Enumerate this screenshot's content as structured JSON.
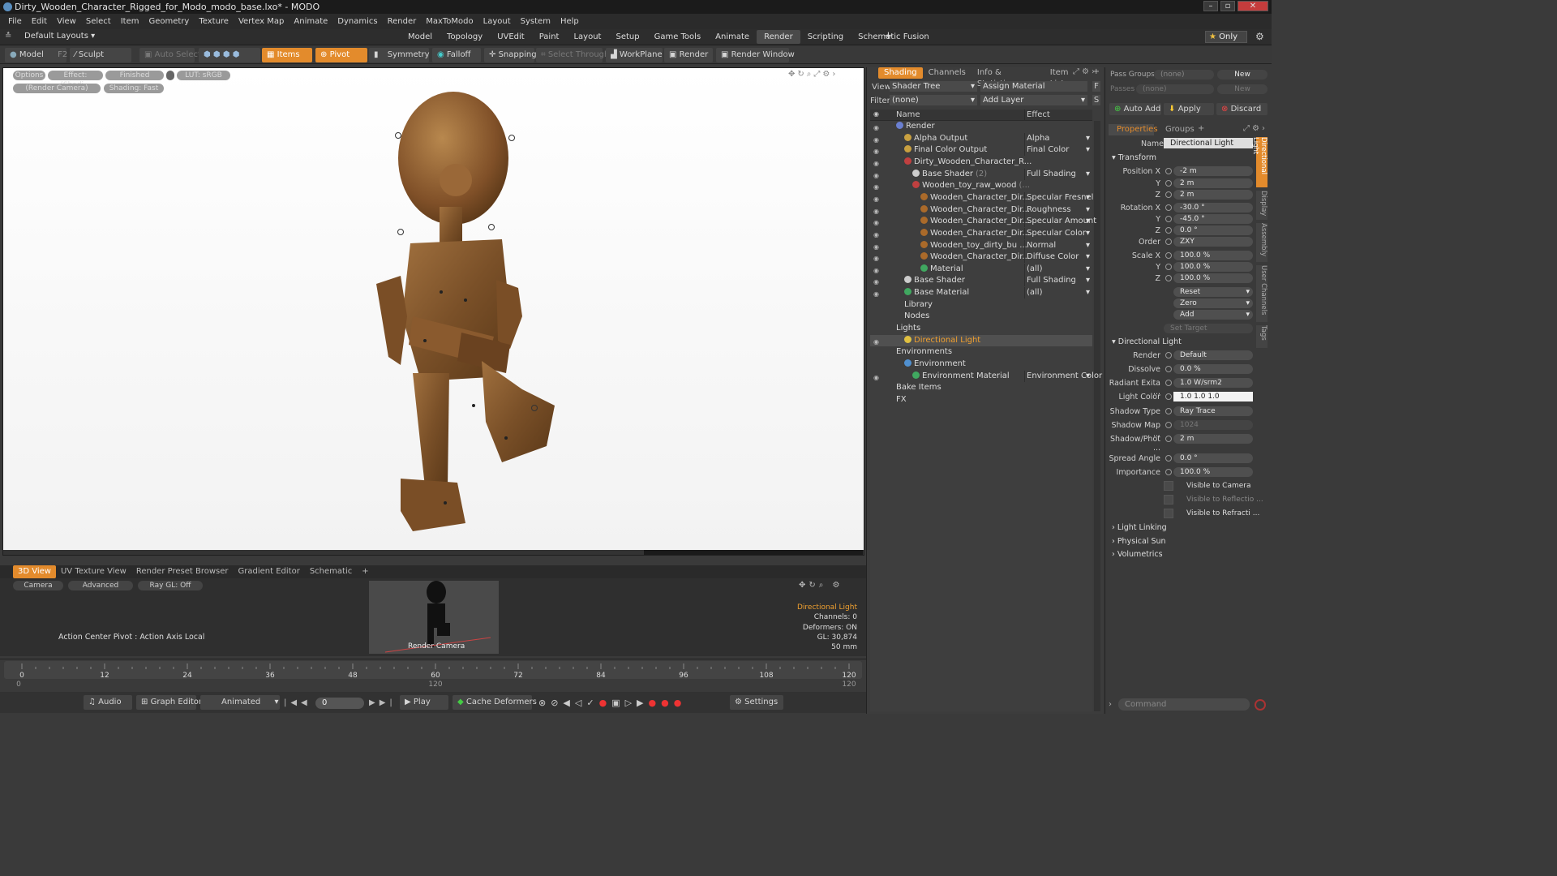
{
  "window": {
    "title": "Dirty_Wooden_Character_Rigged_for_Modo_modo_base.lxo* - MODO"
  },
  "menu": [
    "File",
    "Edit",
    "View",
    "Select",
    "Item",
    "Geometry",
    "Texture",
    "Vertex Map",
    "Animate",
    "Dynamics",
    "Render",
    "MaxToModo",
    "Layout",
    "System",
    "Help"
  ],
  "layoutbar": {
    "layout_label": "Default Layouts",
    "tabs": [
      "Model",
      "Topology",
      "UVEdit",
      "Paint",
      "Layout",
      "Setup",
      "Game Tools",
      "Animate",
      "Render",
      "Scripting",
      "Schematic Fusion"
    ],
    "active_tab": "Render",
    "only_label": "Only"
  },
  "toolbar": {
    "model": "Model",
    "model_key": "F2",
    "sculpt": "Sculpt",
    "auto_select": "Auto Select",
    "items": "Items",
    "pivot": "Pivot",
    "symmetry": "Symmetry",
    "falloff": "Falloff",
    "snapping": "Snapping",
    "select_through": "Select Through",
    "workplane": "WorkPlane",
    "render": "Render",
    "render_window": "Render Window"
  },
  "viewport": {
    "options": "Options",
    "effect": "Effect: (Shadi...",
    "finished": "Finished",
    "lut": "LUT: sRGB",
    "camera": "(Render Camera)",
    "shading": "Shading: Fast"
  },
  "bottom_tabs": [
    "3D View",
    "UV Texture View",
    "Render Preset Browser",
    "Gradient Editor",
    "Schematic"
  ],
  "bottom_active": "3D View",
  "bottom_view": {
    "camera": "Camera",
    "advanced": "Advanced",
    "raygl": "Ray GL: Off",
    "action_center": "Action Center Pivot : Action Axis Local",
    "render_camera": "Render Camera",
    "info": [
      "Directional Light",
      "Channels: 0",
      "Deformers: ON",
      "GL: 30,874",
      "50 mm"
    ]
  },
  "timeline": {
    "ticks": [
      "0",
      "12",
      "24",
      "36",
      "48",
      "60",
      "72",
      "84",
      "96",
      "108",
      "120"
    ],
    "start": "0",
    "end": "120",
    "mid": "120"
  },
  "playbar": {
    "audio": "Audio",
    "graph_editor": "Graph Editor",
    "animated": "Animated",
    "frame": "0",
    "play": "Play",
    "cache": "Cache Deformers",
    "settings": "Settings"
  },
  "shading": {
    "tabs": [
      "Shading",
      "Channels",
      "Info & Statistics",
      "Item List"
    ],
    "view_label": "View",
    "view_value": "Shader Tree",
    "assign": "Assign Material",
    "filter_label": "Filter",
    "filter_value": "(none)",
    "add_layer": "Add Layer",
    "col_name": "Name",
    "col_effect": "Effect",
    "rows": [
      {
        "name": "Render",
        "effect": "",
        "indent": 0,
        "eye": true,
        "icon": "#6a7fd0"
      },
      {
        "name": "Alpha Output",
        "effect": "Alpha",
        "indent": 1,
        "eye": true,
        "icon": "#c8a040"
      },
      {
        "name": "Final Color Output",
        "effect": "Final Color",
        "indent": 1,
        "eye": true,
        "icon": "#c8a040"
      },
      {
        "name": "Dirty_Wooden_Character_R...",
        "effect": "",
        "indent": 1,
        "eye": true,
        "icon": "#c04040"
      },
      {
        "name": "Base Shader",
        "sub": "(2)",
        "effect": "Full Shading",
        "indent": 2,
        "eye": true,
        "icon": "#cccccc"
      },
      {
        "name": "Wooden_toy_raw_wood",
        "sub": "(...",
        "effect": "",
        "indent": 2,
        "eye": true,
        "icon": "#c04040"
      },
      {
        "name": "Wooden_Character_Dir...",
        "effect": "Specular Fresnel",
        "indent": 3,
        "eye": true,
        "icon": "#aa6a2a"
      },
      {
        "name": "Wooden_Character_Dir...",
        "effect": "Roughness",
        "indent": 3,
        "eye": true,
        "icon": "#aa6a2a"
      },
      {
        "name": "Wooden_Character_Dir...",
        "effect": "Specular Amount",
        "indent": 3,
        "eye": true,
        "icon": "#aa6a2a"
      },
      {
        "name": "Wooden_Character_Dir...",
        "effect": "Specular Color",
        "indent": 3,
        "eye": true,
        "icon": "#aa6a2a"
      },
      {
        "name": "Wooden_toy_dirty_bu ...",
        "effect": "Normal",
        "indent": 3,
        "eye": true,
        "icon": "#aa6a2a"
      },
      {
        "name": "Wooden_Character_Dir...",
        "effect": "Diffuse Color",
        "indent": 3,
        "eye": true,
        "icon": "#aa6a2a"
      },
      {
        "name": "Material",
        "effect": "(all)",
        "indent": 3,
        "eye": true,
        "icon": "#40a860"
      },
      {
        "name": "Base Shader",
        "effect": "Full Shading",
        "indent": 1,
        "eye": true,
        "icon": "#cccccc"
      },
      {
        "name": "Base Material",
        "effect": "(all)",
        "indent": 1,
        "eye": true,
        "icon": "#40a860"
      },
      {
        "name": "Library",
        "effect": "",
        "indent": 1,
        "eye": false,
        "icon": ""
      },
      {
        "name": "Nodes",
        "effect": "",
        "indent": 1,
        "eye": false,
        "icon": ""
      },
      {
        "name": "Lights",
        "effect": "",
        "indent": 0,
        "eye": false,
        "icon": ""
      },
      {
        "name": "Directional Light",
        "effect": "",
        "indent": 1,
        "eye": true,
        "icon": "#e0c040",
        "selected": true
      },
      {
        "name": "Environments",
        "effect": "",
        "indent": 0,
        "eye": false,
        "icon": ""
      },
      {
        "name": "Environment",
        "effect": "",
        "indent": 1,
        "eye": false,
        "icon": "#5090d0"
      },
      {
        "name": "Environment Material",
        "effect": "Environment Color",
        "indent": 2,
        "eye": true,
        "icon": "#40a860"
      },
      {
        "name": "Bake Items",
        "effect": "",
        "indent": 0,
        "eye": false,
        "icon": ""
      },
      {
        "name": "FX",
        "effect": "",
        "indent": 0,
        "eye": false,
        "icon": ""
      }
    ]
  },
  "props": {
    "pass_groups": "Pass Groups",
    "pass_groups_val": "(none)",
    "new": "New",
    "passes": "Passes",
    "passes_val": "(none)",
    "auto_add": "Auto Add",
    "apply": "Apply",
    "discard": "Discard",
    "tabs": [
      "Properties",
      "Groups"
    ],
    "name_label": "Name",
    "name_value": "Directional Light",
    "transform": "Transform",
    "fields": [
      {
        "label": "Position X",
        "value": "-2 m"
      },
      {
        "label": "Y",
        "value": "2 m"
      },
      {
        "label": "Z",
        "value": "2 m"
      },
      {
        "label": "Rotation X",
        "value": "-30.0 °"
      },
      {
        "label": "Y",
        "value": "-45.0 °"
      },
      {
        "label": "Z",
        "value": "0.0 °"
      },
      {
        "label": "Order",
        "value": "ZXY"
      },
      {
        "label": "Scale X",
        "value": "100.0 %"
      },
      {
        "label": "Y",
        "value": "100.0 %"
      },
      {
        "label": "Z",
        "value": "100.0 %"
      }
    ],
    "reset": "Reset",
    "zero": "Zero",
    "add": "Add",
    "set_target": "Set Target",
    "dl_section": "Directional Light",
    "dl_fields": [
      {
        "label": "Render",
        "value": "Default"
      },
      {
        "label": "Dissolve",
        "value": "0.0 %"
      },
      {
        "label": "Radiant Exita ...",
        "value": "1.0 W/srm2"
      },
      {
        "label": "Light Color",
        "value": "1.0        1.0        1.0"
      },
      {
        "label": "Shadow Type",
        "value": "Ray Trace"
      },
      {
        "label": "Shadow Map ...",
        "value": "1024"
      },
      {
        "label": "Shadow/Phot ...",
        "value": "2 m"
      },
      {
        "label": "Spread Angle",
        "value": "0.0 °"
      },
      {
        "label": "Importance",
        "value": "100.0 %"
      }
    ],
    "checks": [
      "Visible to Camera",
      "Visible to Reflectio ...",
      "Visible to Refracti ..."
    ],
    "sections": [
      "Light Linking",
      "Physical Sun",
      "Volumetrics"
    ],
    "side_tabs": [
      "Directional Light",
      "Display",
      "Assembly",
      "User Channels",
      "Tags"
    ],
    "command": "Command"
  },
  "colors": {
    "accent": "#e38b2c",
    "selected": "#f0a030"
  }
}
